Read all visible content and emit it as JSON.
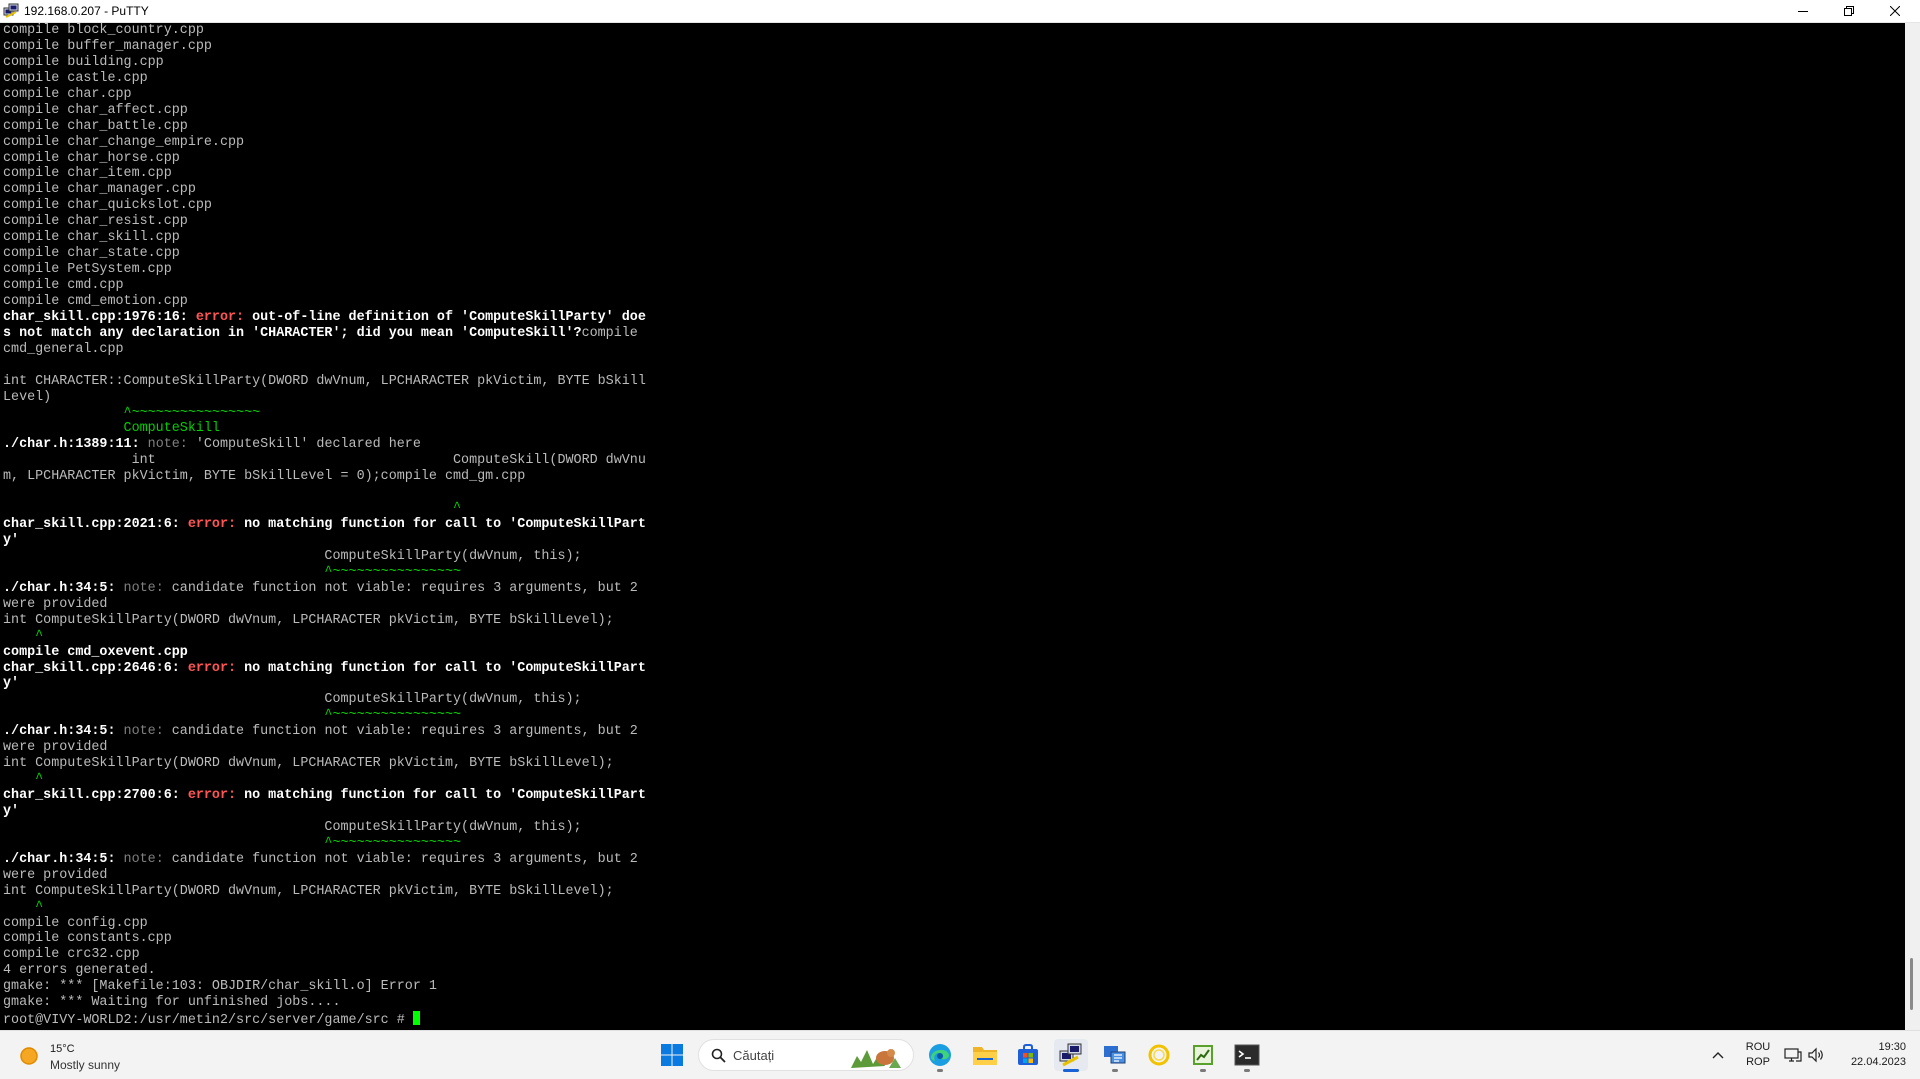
{
  "window": {
    "title": "192.168.0.207 - PuTTY"
  },
  "terminal": {
    "lines": [
      [
        {
          "t": "compile block_country.cpp",
          "c": ""
        }
      ],
      [
        {
          "t": "compile buffer_manager.cpp",
          "c": ""
        }
      ],
      [
        {
          "t": "compile building.cpp",
          "c": ""
        }
      ],
      [
        {
          "t": "compile castle.cpp",
          "c": ""
        }
      ],
      [
        {
          "t": "compile char.cpp",
          "c": ""
        }
      ],
      [
        {
          "t": "compile char_affect.cpp",
          "c": ""
        }
      ],
      [
        {
          "t": "compile char_battle.cpp",
          "c": ""
        }
      ],
      [
        {
          "t": "compile char_change_empire.cpp",
          "c": ""
        }
      ],
      [
        {
          "t": "compile char_horse.cpp",
          "c": ""
        }
      ],
      [
        {
          "t": "compile char_item.cpp",
          "c": ""
        }
      ],
      [
        {
          "t": "compile char_manager.cpp",
          "c": ""
        }
      ],
      [
        {
          "t": "compile char_quickslot.cpp",
          "c": ""
        }
      ],
      [
        {
          "t": "compile char_resist.cpp",
          "c": ""
        }
      ],
      [
        {
          "t": "compile char_skill.cpp",
          "c": ""
        }
      ],
      [
        {
          "t": "compile char_state.cpp",
          "c": ""
        }
      ],
      [
        {
          "t": "compile PetSystem.cpp",
          "c": ""
        }
      ],
      [
        {
          "t": "compile cmd.cpp",
          "c": ""
        }
      ],
      [
        {
          "t": "compile cmd_emotion.cpp",
          "c": ""
        }
      ],
      [
        {
          "t": "char_skill.cpp:1976:16: ",
          "c": "b"
        },
        {
          "t": "error: ",
          "c": "err"
        },
        {
          "t": "out-of-line definition of 'ComputeSkillParty' doe",
          "c": "b"
        }
      ],
      [
        {
          "t": "s not match any declaration in 'CHARACTER'; did you mean 'ComputeSkill'?",
          "c": "b"
        },
        {
          "t": "compile",
          "c": ""
        }
      ],
      [
        {
          "t": "cmd_general.cpp",
          "c": ""
        }
      ],
      [
        {
          "t": "",
          "c": ""
        }
      ],
      [
        {
          "t": "int CHARACTER::ComputeSkillParty(DWORD dwVnum, LPCHARACTER pkVictim, BYTE bSkill",
          "c": ""
        }
      ],
      [
        {
          "t": "Level)",
          "c": ""
        }
      ],
      [
        {
          "t": "               ^~~~~~~~~~~~~~~~~",
          "c": "g"
        }
      ],
      [
        {
          "t": "               ComputeSkill",
          "c": "g"
        }
      ],
      [
        {
          "t": "./char.h:1389:11: ",
          "c": "b"
        },
        {
          "t": "note: ",
          "c": "note"
        },
        {
          "t": "'ComputeSkill' declared here",
          "c": ""
        }
      ],
      [
        {
          "t": "                int                                     ComputeSkill(DWORD dwVnu",
          "c": ""
        }
      ],
      [
        {
          "t": "m, LPCHARACTER pkVictim, BYTE bSkillLevel = 0);compile cmd_gm.cpp",
          "c": ""
        }
      ],
      [
        {
          "t": "",
          "c": ""
        }
      ],
      [
        {
          "t": "                                                        ^",
          "c": "g"
        }
      ],
      [
        {
          "t": "char_skill.cpp:2021:6: ",
          "c": "b"
        },
        {
          "t": "error: ",
          "c": "err"
        },
        {
          "t": "no matching function for call to 'ComputeSkillPart",
          "c": "b"
        }
      ],
      [
        {
          "t": "y'",
          "c": "b"
        }
      ],
      [
        {
          "t": "                                        ComputeSkillParty(dwVnum, this);",
          "c": ""
        }
      ],
      [
        {
          "t": "                                        ^~~~~~~~~~~~~~~~~",
          "c": "g"
        }
      ],
      [
        {
          "t": "./char.h:34:5: ",
          "c": "b"
        },
        {
          "t": "note: ",
          "c": "note"
        },
        {
          "t": "candidate function not viable: requires 3 arguments, but 2",
          "c": ""
        }
      ],
      [
        {
          "t": "were provided",
          "c": ""
        }
      ],
      [
        {
          "t": "int ComputeSkillParty(DWORD dwVnum, LPCHARACTER pkVictim, BYTE bSkillLevel);",
          "c": ""
        }
      ],
      [
        {
          "t": "    ^",
          "c": "g"
        }
      ],
      [
        {
          "t": "compile cmd_oxevent.cpp",
          "c": "b"
        }
      ],
      [
        {
          "t": "char_skill.cpp:2646:6: ",
          "c": "b"
        },
        {
          "t": "error: ",
          "c": "err"
        },
        {
          "t": "no matching function for call to 'ComputeSkillPart",
          "c": "b"
        }
      ],
      [
        {
          "t": "y'",
          "c": "b"
        }
      ],
      [
        {
          "t": "                                        ComputeSkillParty(dwVnum, this);",
          "c": ""
        }
      ],
      [
        {
          "t": "                                        ^~~~~~~~~~~~~~~~~",
          "c": "g"
        }
      ],
      [
        {
          "t": "./char.h:34:5: ",
          "c": "b"
        },
        {
          "t": "note: ",
          "c": "note"
        },
        {
          "t": "candidate function not viable: requires 3 arguments, but 2",
          "c": ""
        }
      ],
      [
        {
          "t": "were provided",
          "c": ""
        }
      ],
      [
        {
          "t": "int ComputeSkillParty(DWORD dwVnum, LPCHARACTER pkVictim, BYTE bSkillLevel);",
          "c": ""
        }
      ],
      [
        {
          "t": "    ^",
          "c": "g"
        }
      ],
      [
        {
          "t": "char_skill.cpp:2700:6: ",
          "c": "b"
        },
        {
          "t": "error: ",
          "c": "err"
        },
        {
          "t": "no matching function for call to 'ComputeSkillPart",
          "c": "b"
        }
      ],
      [
        {
          "t": "y'",
          "c": "b"
        }
      ],
      [
        {
          "t": "                                        ComputeSkillParty(dwVnum, this);",
          "c": ""
        }
      ],
      [
        {
          "t": "                                        ^~~~~~~~~~~~~~~~~",
          "c": "g"
        }
      ],
      [
        {
          "t": "./char.h:34:5: ",
          "c": "b"
        },
        {
          "t": "note: ",
          "c": "note"
        },
        {
          "t": "candidate function not viable: requires 3 arguments, but 2",
          "c": ""
        }
      ],
      [
        {
          "t": "were provided",
          "c": ""
        }
      ],
      [
        {
          "t": "int ComputeSkillParty(DWORD dwVnum, LPCHARACTER pkVictim, BYTE bSkillLevel);",
          "c": ""
        }
      ],
      [
        {
          "t": "    ^",
          "c": "g"
        }
      ],
      [
        {
          "t": "compile config.cpp",
          "c": ""
        }
      ],
      [
        {
          "t": "compile constants.cpp",
          "c": ""
        }
      ],
      [
        {
          "t": "compile crc32.cpp",
          "c": ""
        }
      ],
      [
        {
          "t": "4 errors generated.",
          "c": ""
        }
      ],
      [
        {
          "t": "gmake: *** [Makefile:103: OBJDIR/char_skill.o] Error 1",
          "c": ""
        }
      ],
      [
        {
          "t": "gmake: *** Waiting for unfinished jobs....",
          "c": ""
        }
      ],
      [
        {
          "t": "root@VIVY-WORLD2:/usr/metin2/src/server/game/src # ",
          "c": ""
        },
        {
          "t": "",
          "c": "cursor"
        }
      ]
    ]
  },
  "taskbar": {
    "weather": {
      "temp": "15°C",
      "condition": "Mostly sunny",
      "icon": "sun-icon"
    },
    "search": {
      "placeholder": "Căutați"
    },
    "pinned": [
      {
        "name": "start-button",
        "icon": "windows-logo-icon",
        "active": false
      },
      {
        "name": "edge-icon",
        "icon": "edge-icon",
        "active": false
      },
      {
        "name": "file-explorer-icon",
        "icon": "folder-icon",
        "active": false
      },
      {
        "name": "store-icon",
        "icon": "store-icon",
        "active": false
      },
      {
        "name": "putty-icon",
        "icon": "putty-icon",
        "active": true
      },
      {
        "name": "remote-app-icon",
        "icon": "remote-icon",
        "active": false
      },
      {
        "name": "notes-app-icon",
        "icon": "ring-icon",
        "active": false
      },
      {
        "name": "editor-app-icon",
        "icon": "chart-icon",
        "active": false
      },
      {
        "name": "terminal-app-icon",
        "icon": "terminal-icon",
        "active": false
      }
    ],
    "tray": {
      "lang_line1": "ROU",
      "lang_line2": "ROP",
      "time": "19:30",
      "date": "22.04.2023"
    }
  }
}
